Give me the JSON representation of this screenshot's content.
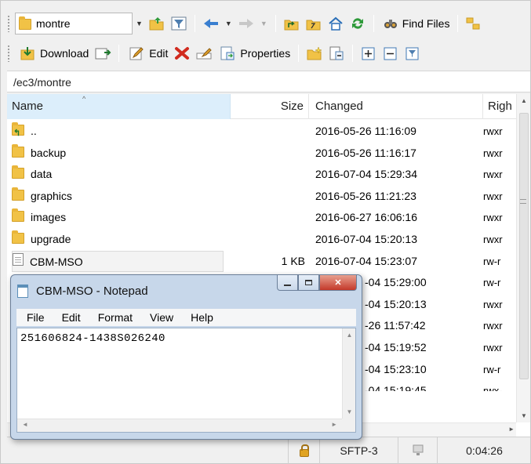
{
  "toolbar1": {
    "path_combo_value": "montre",
    "find_files_label": "Find Files"
  },
  "toolbar2": {
    "download_label": "Download",
    "edit_label": "Edit",
    "properties_label": "Properties"
  },
  "path_bar": {
    "path": "/ec3/montre"
  },
  "file_list": {
    "columns": {
      "name": "Name",
      "size": "Size",
      "changed": "Changed",
      "rights": "Righ"
    },
    "rows": [
      {
        "name": "..",
        "size": "",
        "changed": "2016-05-26 11:16:09",
        "rights": "rwxr",
        "icon": "parent-folder-icon"
      },
      {
        "name": "backup",
        "size": "",
        "changed": "2016-05-26 11:16:17",
        "rights": "rwxr",
        "icon": "folder-icon"
      },
      {
        "name": "data",
        "size": "",
        "changed": "2016-07-04 15:29:34",
        "rights": "rwxr",
        "icon": "folder-icon"
      },
      {
        "name": "graphics",
        "size": "",
        "changed": "2016-05-26 11:21:23",
        "rights": "rwxr",
        "icon": "folder-icon"
      },
      {
        "name": "images",
        "size": "",
        "changed": "2016-06-27 16:06:16",
        "rights": "rwxr",
        "icon": "folder-icon"
      },
      {
        "name": "upgrade",
        "size": "",
        "changed": "2016-07-04 15:20:13",
        "rights": "rwxr",
        "icon": "folder-icon"
      },
      {
        "name": "CBM-MSO",
        "size": "1 KB",
        "changed": "2016-07-04 15:23:07",
        "rights": "rw-r",
        "icon": "file-icon"
      },
      {
        "name": "",
        "size": "",
        "changed": "-04 15:29:00",
        "rights": "rw-r",
        "icon": ""
      },
      {
        "name": "",
        "size": "",
        "changed": "-04 15:20:13",
        "rights": "rwxr",
        "icon": ""
      },
      {
        "name": "",
        "size": "",
        "changed": "-26 11:57:42",
        "rights": "rwxr",
        "icon": ""
      },
      {
        "name": "",
        "size": "",
        "changed": "-04 15:19:52",
        "rights": "rwxr",
        "icon": ""
      },
      {
        "name": "",
        "size": "",
        "changed": "-04 15:23:10",
        "rights": "rw-r",
        "icon": ""
      },
      {
        "name": "",
        "size": "",
        "changed": "-04 15:19:45",
        "rights": "rwx-",
        "icon": ""
      }
    ]
  },
  "status_bar": {
    "protocol": "SFTP-3",
    "elapsed": "0:04:26"
  },
  "notepad": {
    "title": "CBM-MSO - Notepad",
    "menu": [
      "File",
      "Edit",
      "Format",
      "View",
      "Help"
    ],
    "content": "251606824-1438S026240"
  },
  "colors": {
    "folder": "#f1c246",
    "header_selected": "#dceefb",
    "notepad_frame": "#c7d7ea",
    "close_button": "#c4392a"
  }
}
